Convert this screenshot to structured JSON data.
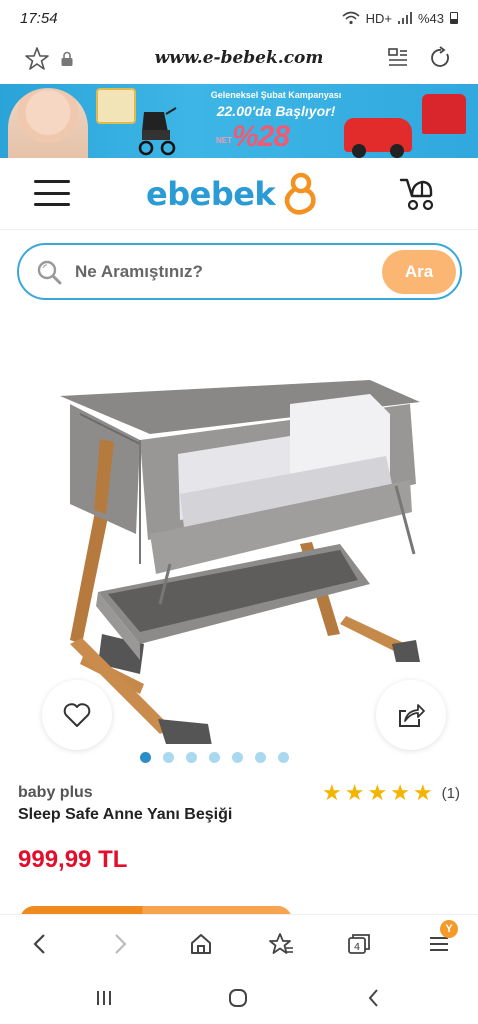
{
  "status": {
    "time": "17:54",
    "indicators": "HD+",
    "battery": "%43"
  },
  "browser": {
    "url": "www.e-bebek.com"
  },
  "banner": {
    "line1": "Geleneksel Şubat Kampanyası",
    "line2": "22.00'da Başlıyor!",
    "discount": "%28",
    "discount_prefix": "NET"
  },
  "header": {
    "logo_text": "ebebek"
  },
  "search": {
    "placeholder": "Ne Aramıştınız?",
    "button_label": "Ara"
  },
  "gallery": {
    "image_count": 7,
    "active_index": 0
  },
  "product": {
    "brand": "baby plus",
    "name": "Sleep Safe Anne Yanı Beşiği",
    "rating": 5,
    "review_count": "(1)",
    "price": "999,99 TL"
  },
  "bottom_nav": {
    "tabs_badge": "Y"
  },
  "colors": {
    "brand_blue": "#2a9bd5",
    "search_button": "#fbb673",
    "price_red": "#e30e2c",
    "star": "#f4b400"
  }
}
